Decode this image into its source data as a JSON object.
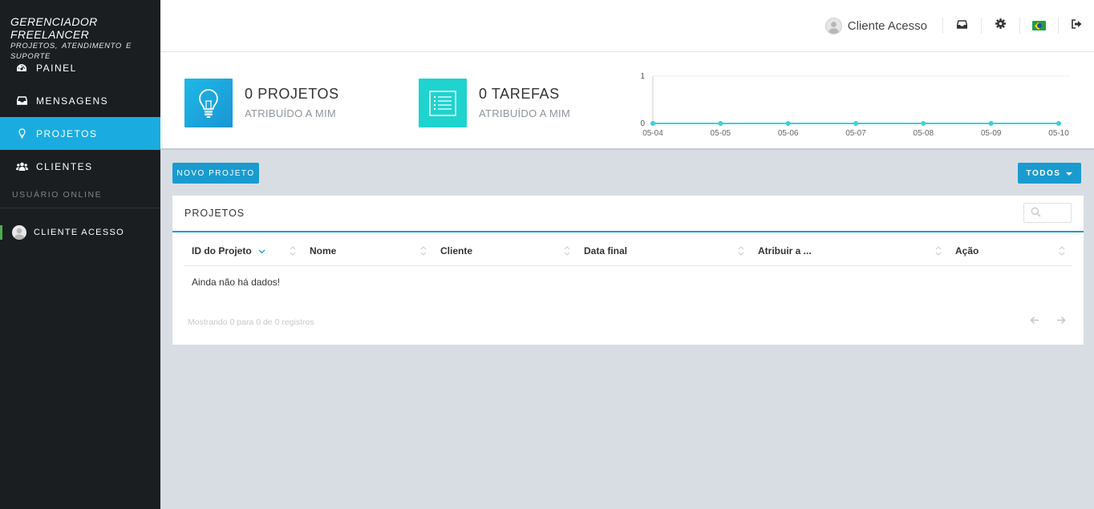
{
  "brand": {
    "title": "GERENCIADOR FREELANCER",
    "subtitle": "PROJETOS, ATENDIMENTO E SUPORTE"
  },
  "sidebar": {
    "items": [
      {
        "label": "PAINEL",
        "icon": "dashboard-icon"
      },
      {
        "label": "MENSAGENS",
        "icon": "inbox-icon"
      },
      {
        "label": "PROJETOS",
        "icon": "lightbulb-icon",
        "active": true
      },
      {
        "label": "CLIENTES",
        "icon": "users-icon"
      }
    ],
    "section_label": "USUÁRIO ONLINE",
    "online_user": "CLIENTE ACESSO"
  },
  "topbar": {
    "user_name": "Cliente Acesso",
    "icons": [
      "inbox-icon",
      "gear-icon",
      "brazil-flag-icon",
      "sign-out-icon"
    ]
  },
  "stats": {
    "projects": {
      "count": "0 PROJETOS",
      "label": "ATRIBUÍDO A MIM",
      "color": "#1aa6dc"
    },
    "tasks": {
      "count": "0 TAREFAS",
      "label": "ATRIBUÍDO A MIM",
      "color": "#1fd3cf"
    }
  },
  "chart_data": {
    "type": "line",
    "categories": [
      "05-04",
      "05-05",
      "05-06",
      "05-07",
      "05-08",
      "05-09",
      "05-10"
    ],
    "series": [
      {
        "values": [
          0,
          0,
          0,
          0,
          0,
          0,
          0
        ]
      }
    ],
    "ylim": [
      0,
      1
    ],
    "yticks": [
      "0",
      "1"
    ],
    "color": "#3dd0d8",
    "grid": true
  },
  "toolbar": {
    "new_project_label": "NOVO PROJETO",
    "filter_label": "TODOS"
  },
  "panel": {
    "title": "PROJETOS",
    "columns": [
      "ID do Projeto",
      "Nome",
      "Cliente",
      "Data final",
      "Atribuir a ...",
      "Ação"
    ],
    "empty_text": "Ainda não há dados!",
    "footer_info": "Mostrando 0 para 0 de 0 registros"
  }
}
